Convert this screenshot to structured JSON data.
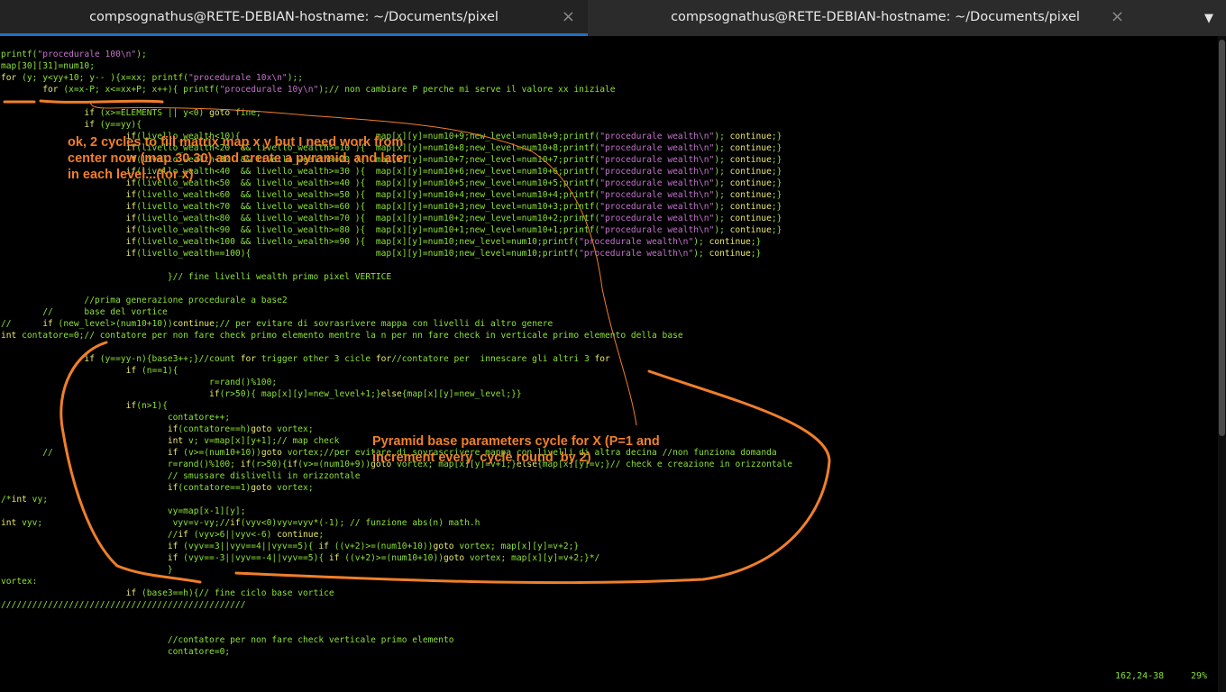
{
  "tabs": [
    {
      "title": "compsognathus@RETE-DEBIAN-hostname: ~/Documents/pixel",
      "active": true
    },
    {
      "title": "compsognathus@RETE-DEBIAN-hostname: ~/Documents/pixel",
      "active": false
    }
  ],
  "icons": {
    "tab_close": "close-icon",
    "menu": "chevron-down-icon"
  },
  "status": {
    "position": "162,24-38",
    "percent": "29%"
  },
  "annotations": {
    "note1": "ok, 2 cycles to fill matrix map x y but I need work from\ncenter now (map 30 30) and create a pyramid, and later\nin each level...(for x)",
    "note2": "Pyramid base parameters cycle for X (P=1 and\nincrement every  cycle round  by 2)"
  },
  "colors": {
    "text": "#8ae234",
    "string": "#c572ce",
    "keyword": "#e8e86c",
    "number": "#5b87d6",
    "annotation": "#f07f2a",
    "tab_accent": "#1a73c2"
  },
  "code_lines": [
    "printf(\"procedurale 100\\n\");",
    "map[30][31]=num10;",
    "for (y; y<yy+10; y-- ){x=xx; printf(\"procedurale 10x\\n\");;",
    "        for (x=x-P; x<=xx+P; x++){ printf(\"procedurale 10y\\n\");// non cambiare P perche mi serve il valore xx iniziale",
    "",
    "                if (x>=ELEMENTS || y<0) goto fine;",
    "                if (y==yy){",
    "                        if(livello_wealth<10){                          map[x][y]=num10+9;new_level=num10+9;printf(\"procedurale wealth\\n\"); continue;}",
    "                        if(livello_wealth<20  && livello_wealth>=10 ){  map[x][y]=num10+8;new_level=num10+8;printf(\"procedurale wealth\\n\"); continue;}",
    "                        if(livello_wealth<30  && livello_wealth>=20 ){  map[x][y]=num10+7;new_level=num10+7;printf(\"procedurale wealth\\n\"); continue;}",
    "                        if(livello_wealth<40  && livello_wealth>=30 ){  map[x][y]=num10+6;new_level=num10+6;printf(\"procedurale wealth\\n\"); continue;}",
    "                        if(livello_wealth<50  && livello_wealth>=40 ){  map[x][y]=num10+5;new_level=num10+5;printf(\"procedurale wealth\\n\"); continue;}",
    "                        if(livello_wealth<60  && livello_wealth>=50 ){  map[x][y]=num10+4;new_level=num10+4;printf(\"procedurale wealth\\n\"); continue;}",
    "                        if(livello_wealth<70  && livello_wealth>=60 ){  map[x][y]=num10+3;new_level=num10+3;printf(\"procedurale wealth\\n\"); continue;}",
    "                        if(livello_wealth<80  && livello_wealth>=70 ){  map[x][y]=num10+2;new_level=num10+2;printf(\"procedurale wealth\\n\"); continue;}",
    "                        if(livello_wealth<90  && livello_wealth>=80 ){  map[x][y]=num10+1;new_level=num10+1;printf(\"procedurale wealth\\n\"); continue;}",
    "                        if(livello_wealth<100 && livello_wealth>=90 ){  map[x][y]=num10;new_level=num10;printf(\"procedurale wealth\\n\"); continue;}",
    "                        if(livello_wealth==100){                        map[x][y]=num10;new_level=num10;printf(\"procedurale wealth\\n\"); continue;}",
    "",
    "                                }// fine livelli wealth primo pixel VERTICE",
    "",
    "                //prima generazione procedurale a base2",
    "        //      base del vortice",
    "//      if (new_level>(num10+10))continue;// per evitare di sovrasrivere mappa con livelli di altro genere",
    "int contatore=0;// contatore per non fare check primo elemento mentre la n per nn fare check in verticale primo elemento della base",
    "",
    "                if (y==yy-n){base3++;}//count for trigger other 3 cicle for//contatore per  innescare gli altri 3 for",
    "                        if (n==1){",
    "                                        r=rand()%100;",
    "                                        if(r>50){ map[x][y]=new_level+1;}else{map[x][y]=new_level;}}",
    "                        if(n>1){",
    "                                contatore++;",
    "                                if(contatore==h)goto vortex;",
    "                                int v; v=map[x][y+1];// map check",
    "        //                      if (v>=(num10+10))goto vortex;//per evitare di sovrascrivere mappa con livelli di altra decina //non funziona domanda",
    "                                r=rand()%100; if(r>50){if(v>=(num10+9))goto vortex; map[x][y]=v+1;}else{map[x][y]=v;}// check e creazione in orizzontale",
    "                                // smussare dislivelli in orizzontale",
    "                                if(contatore==1)goto vortex;",
    "/*int vy;",
    "                                vy=map[x-1][y];",
    "int vyv;                         vyv=v-vy;//if(vyv<0)vyv=vyv*(-1); // funzione abs(n) math.h",
    "                                //if (vyv>6||vyv<-6) continue;",
    "                                if (vyv==3||vyv==4||vyv==5){ if ((v+2)>=(num10+10))goto vortex; map[x][y]=v+2;}",
    "                                if (vyv==-3||vyv==-4||vyv==5){ if ((v+2)>=(num10+10))goto vortex; map[x][y]=v+2;}*/",
    "                                }",
    "vortex:",
    "                        if (base3==h){// fine ciclo base vortice",
    "///////////////////////////////////////////////",
    "",
    "",
    "                                //contatore per non fare check verticale primo elemento",
    "                                contatore=0;"
  ]
}
